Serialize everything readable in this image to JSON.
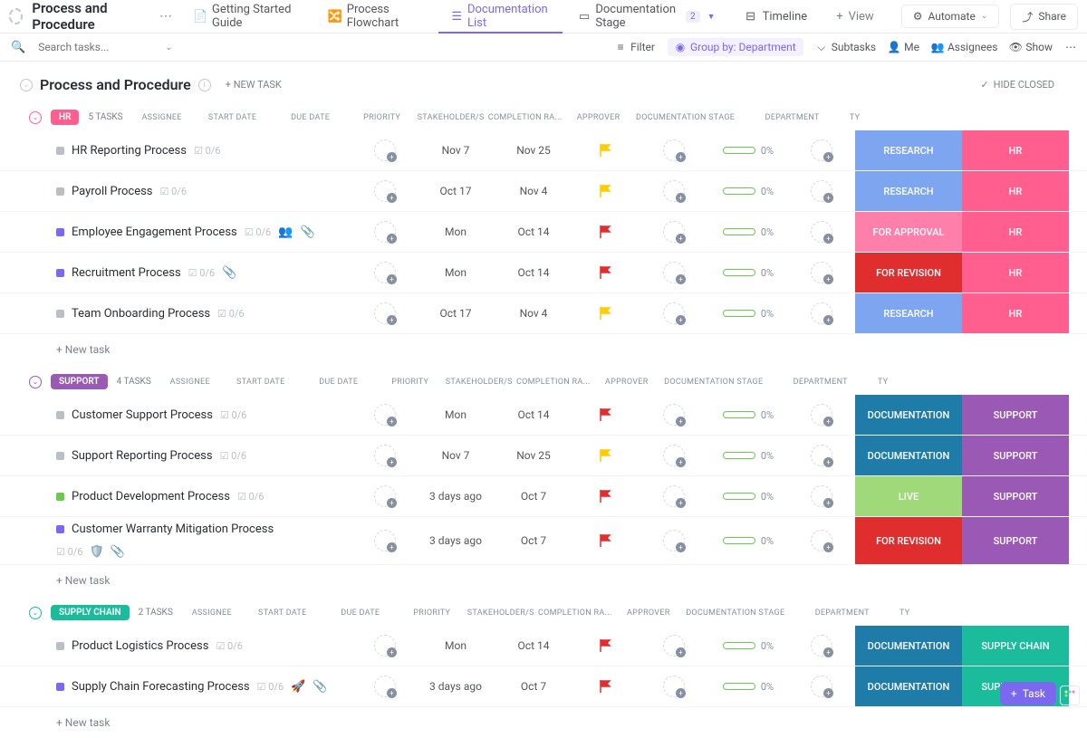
{
  "header": {
    "title": "Process and Procedure",
    "tabs": [
      {
        "label": "Getting Started Guide"
      },
      {
        "label": "Process Flowchart"
      },
      {
        "label": "Documentation List"
      },
      {
        "label": "Documentation Stage",
        "badge": "2"
      },
      {
        "label": "Timeline"
      }
    ],
    "view": "View",
    "automate": "Automate",
    "share": "Share"
  },
  "toolbar": {
    "search_placeholder": "Search tasks...",
    "filter": "Filter",
    "groupby": "Group by: Department",
    "subtasks": "Subtasks",
    "me": "Me",
    "assignees": "Assignees",
    "show": "Show"
  },
  "section": {
    "title": "Process and Procedure",
    "newtask": "+ NEW TASK",
    "hide": "HIDE CLOSED"
  },
  "columns": {
    "assignee": "ASSIGNEE",
    "start": "START DATE",
    "due": "DUE DATE",
    "priority": "PRIORITY",
    "stake": "STAKEHOLDER/S",
    "completion": "COMPLETION RA...",
    "approver": "APPROVER",
    "stage": "DOCUMENTATION STAGE",
    "dept": "DEPARTMENT",
    "type": "TY"
  },
  "groups": [
    {
      "name": "HR",
      "count": "5 TASKS",
      "pill_bg": "#ff5f8f",
      "chev": "#ff5f8f",
      "tasks": [
        {
          "name": "HR Reporting Process",
          "sub": "0/6",
          "status": "#b9bec7",
          "start": "Nov 7",
          "due": "Nov 25",
          "flag": "#ffcc00",
          "pct": "0%",
          "stage": "RESEARCH",
          "stage_bg": "#7ea6f0",
          "dept": "HR",
          "dept_bg": "#ff5f8f"
        },
        {
          "name": "Payroll Process",
          "sub": "0/6",
          "status": "#b9bec7",
          "start": "Oct 17",
          "due": "Nov 4",
          "flag": "#ffcc00",
          "pct": "0%",
          "stage": "RESEARCH",
          "stage_bg": "#7ea6f0",
          "dept": "HR",
          "dept_bg": "#ff5f8f"
        },
        {
          "name": "Employee Engagement Process",
          "sub": "0/6",
          "status": "#7b68ee",
          "start": "Mon",
          "due": "Oct 14",
          "flag": "#e02e2e",
          "pct": "0%",
          "stage": "FOR APPROVAL",
          "stage_bg": "#ff7fab",
          "dept": "HR",
          "dept_bg": "#ff5f8f",
          "icons": [
            "people",
            "attach"
          ]
        },
        {
          "name": "Recruitment Process",
          "sub": "0/6",
          "status": "#7b68ee",
          "start": "Mon",
          "due": "Oct 14",
          "flag": "#e02e2e",
          "pct": "0%",
          "stage": "FOR REVISION",
          "stage_bg": "#e02e2e",
          "dept": "HR",
          "dept_bg": "#ff5f8f",
          "icons": [
            "attach"
          ]
        },
        {
          "name": "Team Onboarding Process",
          "sub": "0/6",
          "status": "#b9bec7",
          "start": "Oct 17",
          "due": "Nov 4",
          "flag": "#ffcc00",
          "pct": "0%",
          "stage": "RESEARCH",
          "stage_bg": "#7ea6f0",
          "dept": "HR",
          "dept_bg": "#ff5f8f"
        }
      ]
    },
    {
      "name": "SUPPORT",
      "count": "4 TASKS",
      "pill_bg": "#9b59b6",
      "chev": "#9b59b6",
      "tasks": [
        {
          "name": "Customer Support Process",
          "sub": "0/6",
          "status": "#b9bec7",
          "start": "Mon",
          "due": "Oct 14",
          "flag": "#e02e2e",
          "pct": "0%",
          "stage": "DOCUMENTATION",
          "stage_bg": "#1f7ba8",
          "dept": "SUPPORT",
          "dept_bg": "#9b59b6"
        },
        {
          "name": "Support Reporting Process",
          "sub": "0/6",
          "status": "#b9bec7",
          "start": "Nov 7",
          "due": "Nov 25",
          "flag": "#ffcc00",
          "pct": "0%",
          "stage": "DOCUMENTATION",
          "stage_bg": "#1f7ba8",
          "dept": "SUPPORT",
          "dept_bg": "#9b59b6"
        },
        {
          "name": "Product Development Process",
          "sub": "0/6",
          "status": "#6bc950",
          "start": "3 days ago",
          "due": "Oct 7",
          "flag": "#e02e2e",
          "pct": "0%",
          "stage": "LIVE",
          "stage_bg": "#9fd97a",
          "dept": "SUPPORT",
          "dept_bg": "#9b59b6"
        },
        {
          "name": "Customer Warranty Mitigation Process",
          "sub": "0/6",
          "status": "#7b68ee",
          "start": "3 days ago",
          "due": "Oct 7",
          "flag": "#e02e2e",
          "pct": "0%",
          "stage": "FOR REVISION",
          "stage_bg": "#e02e2e",
          "dept": "SUPPORT",
          "dept_bg": "#9b59b6",
          "icons": [
            "shield",
            "attach"
          ],
          "multi": true
        }
      ]
    },
    {
      "name": "SUPPLY CHAIN",
      "count": "2 TASKS",
      "pill_bg": "#1abc9c",
      "chev": "#1abc9c",
      "tasks": [
        {
          "name": "Product Logistics Process",
          "sub": "0/6",
          "status": "#b9bec7",
          "start": "Mon",
          "due": "Oct 14",
          "flag": "#e02e2e",
          "pct": "0%",
          "stage": "DOCUMENTATION",
          "stage_bg": "#1f7ba8",
          "dept": "SUPPLY CHAIN",
          "dept_bg": "#1abc9c"
        },
        {
          "name": "Supply Chain Forecasting Process",
          "sub": "0/6",
          "status": "#7b68ee",
          "start": "3 days ago",
          "due": "Oct 7",
          "flag": "#e02e2e",
          "pct": "0%",
          "stage": "DOCUMENTATION",
          "stage_bg": "#1f7ba8",
          "dept": "SUPPLY CHAIN",
          "dept_bg": "#1abc9c",
          "icons": [
            "rocket",
            "attach"
          ]
        }
      ]
    }
  ],
  "newtask_row": "+ New task",
  "task_button": "Task"
}
